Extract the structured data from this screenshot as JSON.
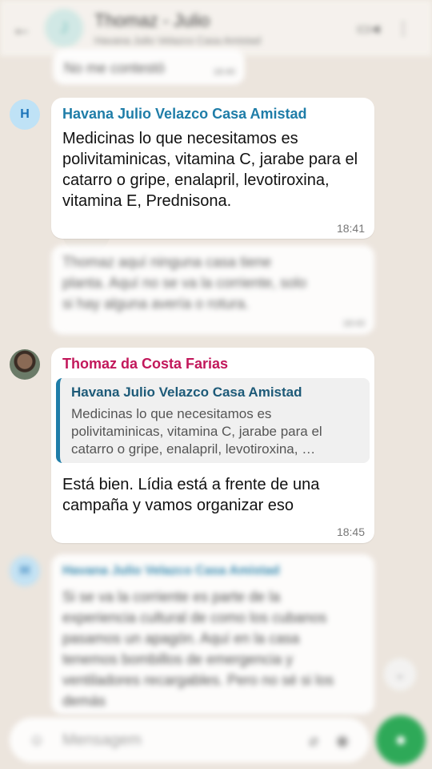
{
  "header": {
    "title": "Thomaz - Julio",
    "subtitle": "Havana Julio Velazco Casa Amistad",
    "avatar_letter": "J"
  },
  "messages": [
    {
      "sender": "",
      "text": "No me contestó",
      "time": "18:40"
    },
    {
      "avatar_letter": "H",
      "sender": "Havana Julio Velazco Casa Amistad",
      "text": "Medicinas lo que necesitamos es polivitaminicas, vitamina C, jarabe para el catarro o gripe, enalapril, levotiroxina, vitamina E, Prednisona.",
      "time": "18:41"
    },
    {
      "sender": "",
      "text": "Thomaz aquí ninguna casa tiene planta. Aquí no se va la corriente, solo si hay alguna avería o rotura.",
      "time": "18:43"
    },
    {
      "sender": "Thomaz da Costa Farias",
      "quote_name": "Havana Julio Velazco Casa Amistad",
      "quote_text": "Medicinas lo que necesitamos es polivitaminicas, vitamina C, jarabe para el catarro o gripe, enalapril, levotiroxina, …",
      "text": "Está bien. Lídia está a frente de una campaña y vamos organizar eso",
      "time": "18:45"
    },
    {
      "avatar_letter": "H",
      "sender": "Havana Julio Velazco Casa Amistad",
      "text": "Si se va la corriente es parte de la experiencia cultural de como los cubanos pasamos un apagón. Aquí en la casa tenemos bombillos de emergencia y ventiladores recargables. Pero no sé si los demás"
    }
  ],
  "input": {
    "placeholder": "Mensagem"
  },
  "colors": {
    "sender_blue": "#1f7da8",
    "sender_pink": "#c2185b",
    "send_green": "#1aa34a"
  }
}
